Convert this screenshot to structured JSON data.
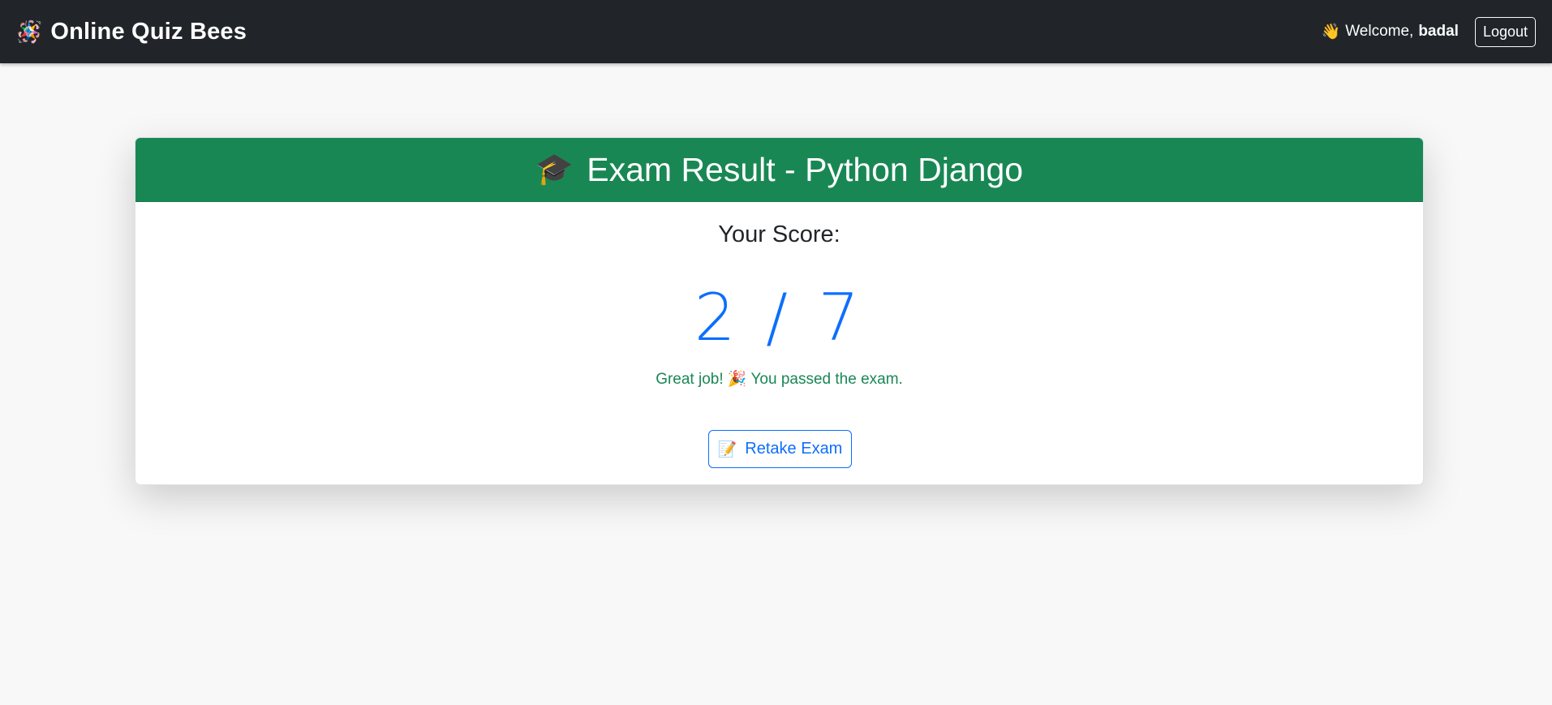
{
  "navbar": {
    "brand_icon": "🪅",
    "brand_title": "Online Quiz Bees",
    "welcome_icon": "👋",
    "welcome_prefix": "Welcome,",
    "username": "badal",
    "logout_label": "Logout"
  },
  "result": {
    "header_icon": "🎓",
    "header_title": "Exam Result - Python Django",
    "score_label": "Your Score:",
    "score_value": "2 / 7",
    "pass_message": "Great job! 🎉 You passed the exam.",
    "retake_icon": "📝",
    "retake_label": "Retake Exam"
  },
  "colors": {
    "navbar_bg": "#212529",
    "header_bg": "#198754",
    "score_color": "#0d6efd",
    "success_text": "#198754"
  }
}
